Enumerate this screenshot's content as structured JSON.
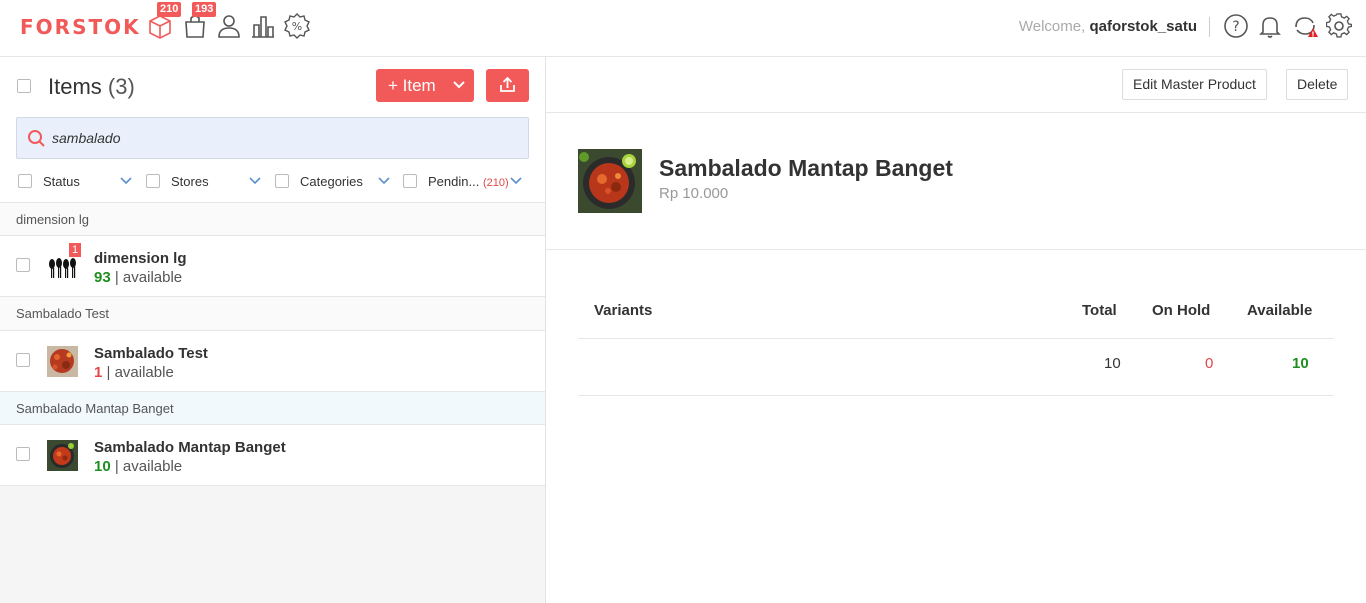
{
  "app": {
    "logo": "FORSTOK"
  },
  "nav": {
    "badges": {
      "products": "210",
      "orders": "193"
    }
  },
  "header": {
    "welcome_prefix": "Welcome,",
    "username": "qaforstok_satu"
  },
  "items_panel": {
    "title": "Items",
    "count": "(3)",
    "add_item_label": "+ Item",
    "search": {
      "value": "sambalado",
      "placeholder": ""
    },
    "filters": [
      {
        "label": "Status"
      },
      {
        "label": "Stores"
      },
      {
        "label": "Categories"
      },
      {
        "label": "Pendin...",
        "count": "(210)"
      }
    ],
    "groups": [
      {
        "header": "dimension lg",
        "name": "dimension lg",
        "qty": "93",
        "available_text": "| available",
        "badge": "1"
      },
      {
        "header": "Sambalado Test",
        "name": "Sambalado Test",
        "qty": "1",
        "available_text": "| available"
      },
      {
        "header": "Sambalado Mantap Banget",
        "name": "Sambalado Mantap Banget",
        "qty": "10",
        "available_text": "| available"
      }
    ]
  },
  "detail": {
    "edit_button": "Edit Master Product",
    "delete_button": "Delete",
    "product_name": "Sambalado Mantap Banget",
    "price": "Rp 10.000",
    "variants_table": {
      "headers": {
        "variants": "Variants",
        "total": "Total",
        "on_hold": "On Hold",
        "available": "Available"
      },
      "rows": [
        {
          "variant": "",
          "total": "10",
          "on_hold": "0",
          "available": "10"
        }
      ]
    }
  },
  "colors": {
    "accent": "#f25a5a",
    "green": "#1f8f1f",
    "red": "#e04848"
  }
}
